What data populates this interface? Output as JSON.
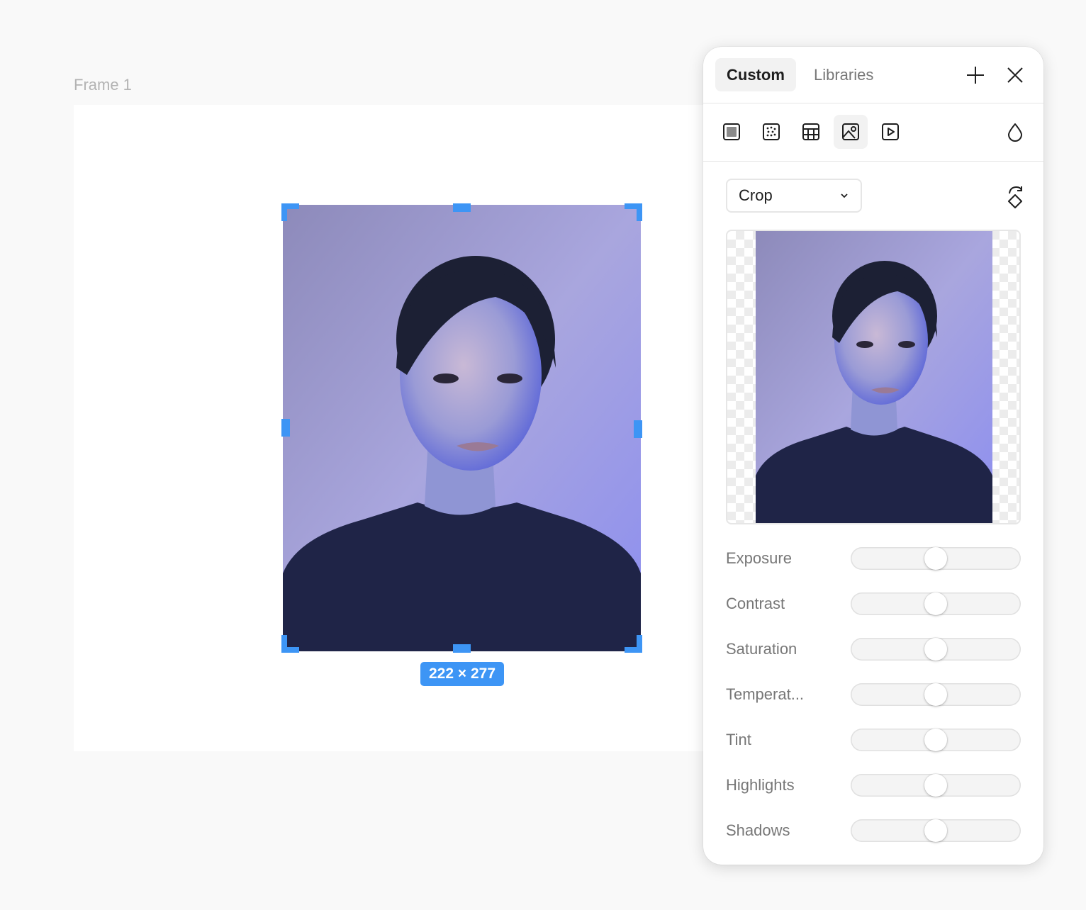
{
  "canvas": {
    "frame_label": "Frame 1",
    "selection_size": "222 × 277",
    "selection_color": "#3d95f5"
  },
  "panel": {
    "tabs": [
      {
        "label": "Custom",
        "active": true
      },
      {
        "label": "Libraries",
        "active": false
      }
    ],
    "header_icons": [
      "plus-icon",
      "close-icon"
    ],
    "tools": [
      {
        "icon": "solid-fill-icon",
        "selected": false
      },
      {
        "icon": "noise-fill-icon",
        "selected": false
      },
      {
        "icon": "pattern-fill-icon",
        "selected": false
      },
      {
        "icon": "image-fill-icon",
        "selected": true
      },
      {
        "icon": "video-fill-icon",
        "selected": false
      }
    ],
    "blend_icon": "drop-icon",
    "mode_select": {
      "value": "Crop"
    },
    "rotate_icon": "rotate-icon",
    "adjustments": [
      {
        "label": "Exposure",
        "value": 0.5
      },
      {
        "label": "Contrast",
        "value": 0.5
      },
      {
        "label": "Saturation",
        "value": 0.5
      },
      {
        "label": "Temperat...",
        "value": 0.5
      },
      {
        "label": "Tint",
        "value": 0.5
      },
      {
        "label": "Highlights",
        "value": 0.5
      },
      {
        "label": "Shadows",
        "value": 0.5
      }
    ]
  }
}
